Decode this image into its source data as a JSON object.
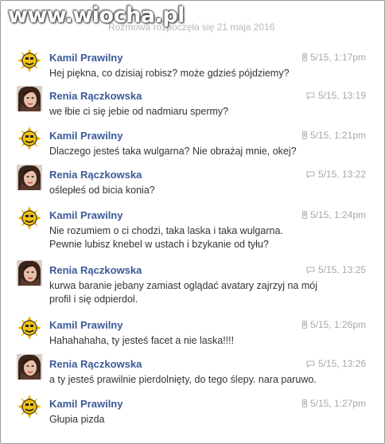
{
  "watermark": "www.wiocha.pl",
  "conversation_started": "Rozmowa rozpoczęła się 21 maja 2016",
  "messages": [
    {
      "sender": "Kamil Prawilny",
      "time": "5/15, 1:17pm",
      "device": "mobile",
      "lines": [
        "Hej piękna, co dzisiaj robisz? może gdzieś pójdziemy?"
      ]
    },
    {
      "sender": "Renia Rączkowska",
      "time": "5/15, 13:19",
      "device": "chat",
      "lines": [
        "we łbie ci się jebie od nadmiaru spermy?"
      ]
    },
    {
      "sender": "Kamil Prawilny",
      "time": "5/15, 1:21pm",
      "device": "mobile",
      "lines": [
        "Dlaczego jesteś taka wulgarna? Nie obrażaj mnie, okej?"
      ]
    },
    {
      "sender": "Renia Rączkowska",
      "time": "5/15, 13:22",
      "device": "chat",
      "lines": [
        "oślepłeś od bicia konia?"
      ]
    },
    {
      "sender": "Kamil Prawilny",
      "time": "5/15, 1:24pm",
      "device": "mobile",
      "lines": [
        "Nie rozumiem o ci chodzi, taka laska i taka wulgarna.",
        "Pewnie lubisz knebel w ustach i bzykanie od tyłu?"
      ]
    },
    {
      "sender": "Renia Rączkowska",
      "time": "5/15, 13:25",
      "device": "chat",
      "lines": [
        "kurwa baranie jebany zamiast oglądać avatary zajrzyj na mój",
        "profil i się odpierdol."
      ]
    },
    {
      "sender": "Kamil Prawilny",
      "time": "5/15, 1:26pm",
      "device": "mobile",
      "lines": [
        "Hahahahaha, ty jesteś facet a nie laska!!!!"
      ]
    },
    {
      "sender": "Renia Rączkowska",
      "time": "5/15, 13:26",
      "device": "chat",
      "lines": [
        "a ty jesteś prawilnie pierdolnięty, do tego ślepy. nara paruwo."
      ]
    },
    {
      "sender": "Kamil Prawilny",
      "time": "5/15, 1:27pm",
      "device": "mobile",
      "lines": [
        "Głupia pizda"
      ]
    }
  ],
  "colors": {
    "name": "#3b5998",
    "text": "#333333",
    "meta": "#a8a8a8"
  },
  "icons": {
    "mobile": "phone-icon",
    "chat": "chat-bubble-icon",
    "kamil_avatar": "sun-face-avatar",
    "renia_avatar": "woman-photo-avatar"
  }
}
